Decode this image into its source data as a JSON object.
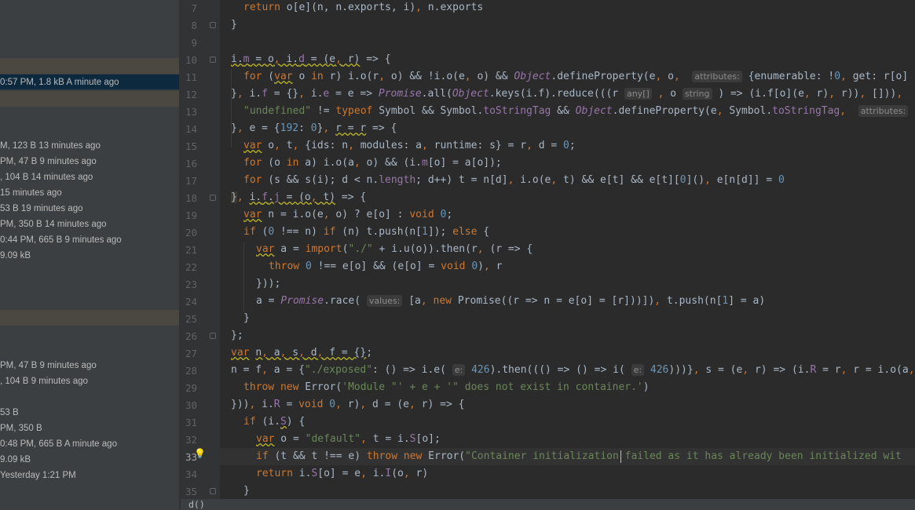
{
  "sidebar": {
    "items": [
      {
        "text": "0:57 PM, 1.8 kB A minute ago",
        "selected": true
      },
      {
        "text": "M, 123 B 13 minutes ago"
      },
      {
        "text": "PM, 47 B 9 minutes ago"
      },
      {
        "text": ", 104 B 14 minutes ago"
      },
      {
        "text": " 15 minutes ago"
      },
      {
        "text": "53 B 19 minutes ago"
      },
      {
        "text": "PM, 350 B 14 minutes ago"
      },
      {
        "text": "0:44 PM, 665 B 9 minutes ago"
      },
      {
        "text": "9.09 kB"
      },
      {
        "text": "PM, 47 B 9 minutes ago"
      },
      {
        "text": ", 104 B 9 minutes ago"
      },
      {
        "text": "53 B"
      },
      {
        "text": "PM, 350 B"
      },
      {
        "text": "0:48 PM, 665 B A minute ago"
      },
      {
        "text": "9.09 kB"
      },
      {
        "text": "Yesterday 1:21 PM"
      }
    ]
  },
  "editor": {
    "line_numbers": [
      "7",
      "8",
      "9",
      "10",
      "11",
      "12",
      "13",
      "14",
      "15",
      "16",
      "17",
      "18",
      "19",
      "20",
      "21",
      "22",
      "23",
      "24",
      "25",
      "26",
      "27",
      "28",
      "29",
      "30",
      "31",
      "32",
      "33",
      "34",
      "35"
    ],
    "current_line": "33",
    "hints": {
      "attributes": "attributes:",
      "any": "any[]",
      "string": "string",
      "values": "values:",
      "e": "e:"
    }
  },
  "statusbar": {
    "breadcrumb": "d()"
  },
  "colors": {
    "background": "#2b2b2b",
    "gutter": "#313335",
    "keyword": "#cc7832",
    "number": "#6897bb",
    "string": "#6a8759",
    "field": "#9876aa",
    "text": "#a9b7c6",
    "bulb": "#f2c55c"
  }
}
